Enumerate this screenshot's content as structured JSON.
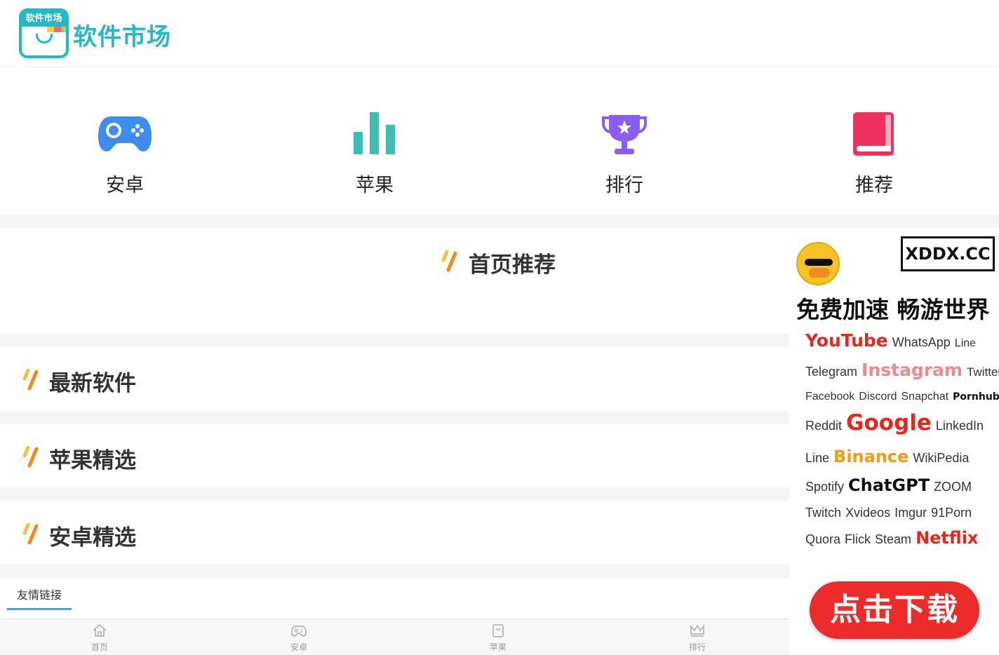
{
  "header": {
    "logo_tag": "软件市场",
    "logo_text": "软件市场"
  },
  "nav": [
    {
      "label": "安卓",
      "icon": "gamepad-icon",
      "color": "#3f8cf0"
    },
    {
      "label": "苹果",
      "icon": "bar-chart-icon",
      "color": "#3cbfb0"
    },
    {
      "label": "排行",
      "icon": "trophy-icon",
      "color": "#8a5cf0"
    },
    {
      "label": "推荐",
      "icon": "book-icon",
      "color": "#f0305e"
    }
  ],
  "sections": {
    "home": "首页推荐",
    "latest": "最新软件",
    "apple": "苹果精选",
    "android": "安卓精选"
  },
  "links_tab": "友情链接",
  "tabbar": [
    {
      "label": "首页",
      "icon": "home-icon"
    },
    {
      "label": "安卓",
      "icon": "gamepad-icon"
    },
    {
      "label": "苹果",
      "icon": "bag-icon"
    },
    {
      "label": "排行",
      "icon": "crown-icon"
    }
  ],
  "ad": {
    "badge": "XDDX.CC",
    "headline": "免费加速 畅游世界",
    "lines": [
      [
        "YouTube",
        "WhatsApp",
        "Line"
      ],
      [
        "Telegram",
        "Instagram",
        "Twitter"
      ],
      [
        "Facebook",
        "Discord",
        "Snapchat",
        "Pornhub"
      ],
      [
        "Reddit",
        "Google",
        "LinkedIn"
      ],
      [
        "Line",
        "Binance",
        "WikiPedia"
      ],
      [
        "Spotify",
        "ChatGPT",
        "ZOOM"
      ],
      [
        "Twitch",
        "Xvideos",
        "Imgur",
        "91Porn"
      ],
      [
        "Quora",
        "Flick",
        "Steam",
        "Netflix"
      ]
    ],
    "download": "点击下载"
  },
  "colors": {
    "accent": "#22b8c4",
    "ad_button": "#ee2b2b",
    "slash_gradient": [
      "#f7c230",
      "#f08a1e"
    ]
  }
}
